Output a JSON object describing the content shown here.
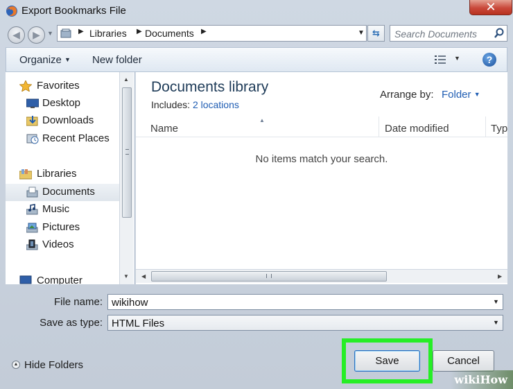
{
  "window": {
    "title": "Export Bookmarks File",
    "close_label": "✕"
  },
  "address": {
    "crumbs": [
      "Libraries",
      "Documents"
    ],
    "search_placeholder": "Search Documents"
  },
  "toolbar": {
    "organize": "Organize",
    "new_folder": "New folder",
    "help": "?"
  },
  "navigation": {
    "favorites": {
      "label": "Favorites",
      "items": [
        "Desktop",
        "Downloads",
        "Recent Places"
      ]
    },
    "libraries": {
      "label": "Libraries",
      "items": [
        "Documents",
        "Music",
        "Pictures",
        "Videos"
      ]
    },
    "computer": "Computer",
    "selected": "Documents"
  },
  "content": {
    "title": "Documents library",
    "includes_label": "Includes:",
    "includes_link": "2 locations",
    "arrange_label": "Arrange by:",
    "arrange_value": "Folder",
    "columns": [
      "Name",
      "Date modified",
      "Typ"
    ],
    "empty_message": "No items match your search."
  },
  "form": {
    "file_name_label": "File name:",
    "file_name_value": "wikihow",
    "save_type_label": "Save as type:",
    "save_type_value": "HTML Files"
  },
  "footer": {
    "hide_folders": "Hide Folders",
    "save": "Save",
    "cancel": "Cancel",
    "watermark": "wikiHow"
  },
  "colors": {
    "highlight": "#26ee26",
    "link": "#1f5db3",
    "title": "#1e3b58"
  }
}
